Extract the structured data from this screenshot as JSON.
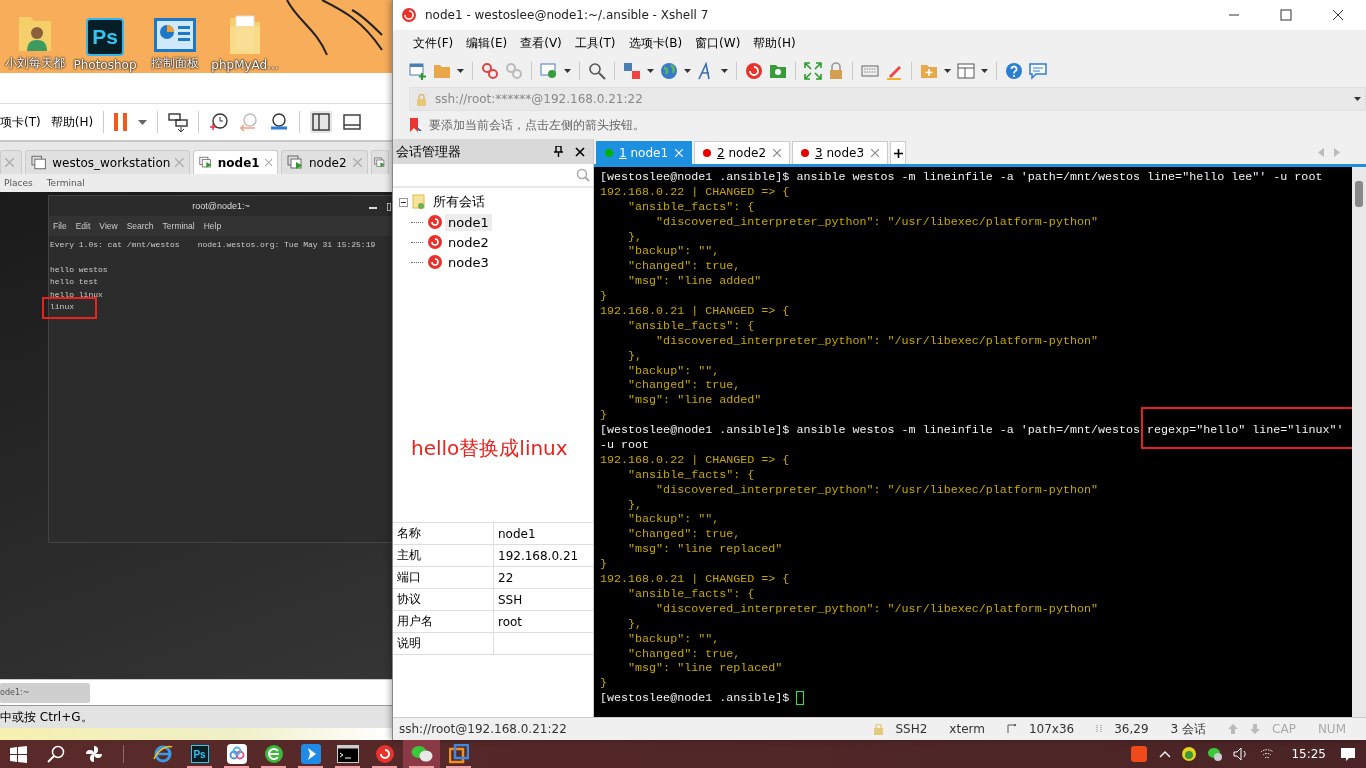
{
  "desktop": {
    "icons": [
      {
        "kind": "user-folder",
        "label": "小刘每天都"
      },
      {
        "kind": "photoshop",
        "glyph": "Ps",
        "label": "Photoshop"
      },
      {
        "kind": "control-panel",
        "label": "控制面板"
      },
      {
        "kind": "folder",
        "label": "phpMyAd..."
      }
    ]
  },
  "vmware": {
    "menu": [
      "项卡(T)",
      "帮助(H)"
    ],
    "tabs": [
      {
        "label": "westos_workstation",
        "kind": "vm-off",
        "selected": false
      },
      {
        "label": "node1",
        "kind": "vm-on",
        "selected": true
      },
      {
        "label": "node2",
        "kind": "vm-on",
        "selected": false
      }
    ],
    "gnome_bar": [
      "Places",
      "Terminal"
    ],
    "vm_terminal": {
      "title": "root@node1:~",
      "menu": [
        "File",
        "Edit",
        "View",
        "Search",
        "Terminal",
        "Help"
      ],
      "header_left": "Every 1.0s: cat /mnt/westos",
      "header_right": "node1.westos.org: Tue May 31 15:25:19",
      "lines": [
        {
          "text": "hello westos",
          "highlighted": false
        },
        {
          "text": "hello test",
          "highlighted": false
        },
        {
          "text": "hello linux",
          "highlighted": false
        },
        {
          "text": "linux",
          "highlighted": true
        }
      ]
    },
    "bottom_tab": "ode1:~",
    "status": "中或按 Ctrl+G。"
  },
  "annotation": "hello替换成linux",
  "xshell": {
    "title": "node1 - westoslee@node1:~/.ansible - Xshell 7",
    "menu": [
      "文件(F)",
      "编辑(E)",
      "查看(V)",
      "工具(T)",
      "选项卡(B)",
      "窗口(W)",
      "帮助(H)"
    ],
    "address": "ssh://root:******@192.168.0.21:22",
    "hint": "要添加当前会话，点击左侧的箭头按钮。",
    "session_manager": {
      "title": "会话管理器",
      "tree": [
        {
          "label": "所有会话",
          "expanded": true,
          "selected": false,
          "children": [
            {
              "label": "node1",
              "selected": true
            },
            {
              "label": "node2",
              "selected": false
            },
            {
              "label": "node3",
              "selected": false
            }
          ]
        }
      ]
    },
    "properties": [
      {
        "name": "名称",
        "value": "node1"
      },
      {
        "name": "主机",
        "value": "192.168.0.21"
      },
      {
        "name": "端口",
        "value": "22"
      },
      {
        "name": "协议",
        "value": "SSH"
      },
      {
        "name": "用户名",
        "value": "root"
      },
      {
        "name": "说明"
      }
    ],
    "tabs": [
      {
        "number": "1",
        "label": "node1",
        "color": "#00b300",
        "selected": true
      },
      {
        "number": "2",
        "label": "node2",
        "color": "#e60000",
        "selected": false
      },
      {
        "number": "3",
        "label": "node3",
        "color": "#e60000",
        "selected": false
      }
    ],
    "terminal": {
      "lines": [
        {
          "kind": "command",
          "text": "[westoslee@node1 .ansible]$ ansible westos -m lineinfile -a 'path=/mnt/westos line=\"hello lee\"' -u root"
        },
        {
          "kind": "output",
          "text": "192.168.0.22 | CHANGED => {"
        },
        {
          "kind": "output",
          "text": "    \"ansible_facts\": {"
        },
        {
          "kind": "output",
          "text": "        \"discovered_interpreter_python\": \"/usr/libexec/platform-python\""
        },
        {
          "kind": "output",
          "text": "    },"
        },
        {
          "kind": "output",
          "text": "    \"backup\": \"\","
        },
        {
          "kind": "output",
          "text": "    \"changed\": true,"
        },
        {
          "kind": "output",
          "text": "    \"msg\": \"line added\""
        },
        {
          "kind": "output",
          "text": "}"
        },
        {
          "kind": "output",
          "text": "192.168.0.21 | CHANGED => {"
        },
        {
          "kind": "output",
          "text": "    \"ansible_facts\": {"
        },
        {
          "kind": "output",
          "text": "        \"discovered_interpreter_python\": \"/usr/libexec/platform-python\""
        },
        {
          "kind": "output",
          "text": "    },"
        },
        {
          "kind": "output",
          "text": "    \"backup\": \"\","
        },
        {
          "kind": "output",
          "text": "    \"changed\": true,"
        },
        {
          "kind": "output",
          "text": "    \"msg\": \"line added\""
        },
        {
          "kind": "output",
          "text": "}"
        },
        {
          "kind": "command",
          "text": "[westoslee@node1 .ansible]$ ansible westos -m lineinfile -a 'path=/mnt/westos ",
          "marked": "regexp=\"hello\" line=\"linux\"'"
        },
        {
          "kind": "command",
          "text": "-u root"
        },
        {
          "kind": "output",
          "text": "192.168.0.22 | CHANGED => {"
        },
        {
          "kind": "output",
          "text": "    \"ansible_facts\": {"
        },
        {
          "kind": "output",
          "text": "        \"discovered_interpreter_python\": \"/usr/libexec/platform-python\""
        },
        {
          "kind": "output",
          "text": "    },"
        },
        {
          "kind": "output",
          "text": "    \"backup\": \"\","
        },
        {
          "kind": "output",
          "text": "    \"changed\": true,"
        },
        {
          "kind": "output",
          "text": "    \"msg\": \"line replaced\""
        },
        {
          "kind": "output",
          "text": "}"
        },
        {
          "kind": "output",
          "text": "192.168.0.21 | CHANGED => {"
        },
        {
          "kind": "output",
          "text": "    \"ansible_facts\": {"
        },
        {
          "kind": "output",
          "text": "        \"discovered_interpreter_python\": \"/usr/libexec/platform-python\""
        },
        {
          "kind": "output",
          "text": "    },"
        },
        {
          "kind": "output",
          "text": "    \"backup\": \"\","
        },
        {
          "kind": "output",
          "text": "    \"changed\": true,"
        },
        {
          "kind": "output",
          "text": "    \"msg\": \"line replaced\""
        },
        {
          "kind": "output",
          "text": "}"
        },
        {
          "kind": "prompt",
          "text": "[westoslee@node1 .ansible]$ "
        }
      ]
    },
    "status_bar": {
      "address": "ssh://root@192.168.0.21:22",
      "protocol": "SSH2",
      "terminal_type": "xterm",
      "size": "107x36",
      "cursor": "36,29",
      "sessions": "3 会话",
      "caps": "CAP",
      "num": "NUM"
    }
  },
  "taskbar": {
    "apps": [
      {
        "kind": "ie",
        "running": false,
        "selected": false
      },
      {
        "kind": "photoshop",
        "glyph": "Ps",
        "running": true,
        "selected": false
      },
      {
        "kind": "cloud",
        "running": true,
        "selected": false
      },
      {
        "kind": "browser",
        "running": true,
        "selected": false
      },
      {
        "kind": "arrow",
        "running": true,
        "selected": false
      },
      {
        "kind": "console",
        "running": true,
        "selected": false
      },
      {
        "kind": "swirl",
        "running": true,
        "selected": false
      },
      {
        "kind": "chat",
        "running": true,
        "selected": true
      },
      {
        "kind": "vm",
        "running": true,
        "selected": false
      }
    ],
    "clock": "15:25"
  }
}
